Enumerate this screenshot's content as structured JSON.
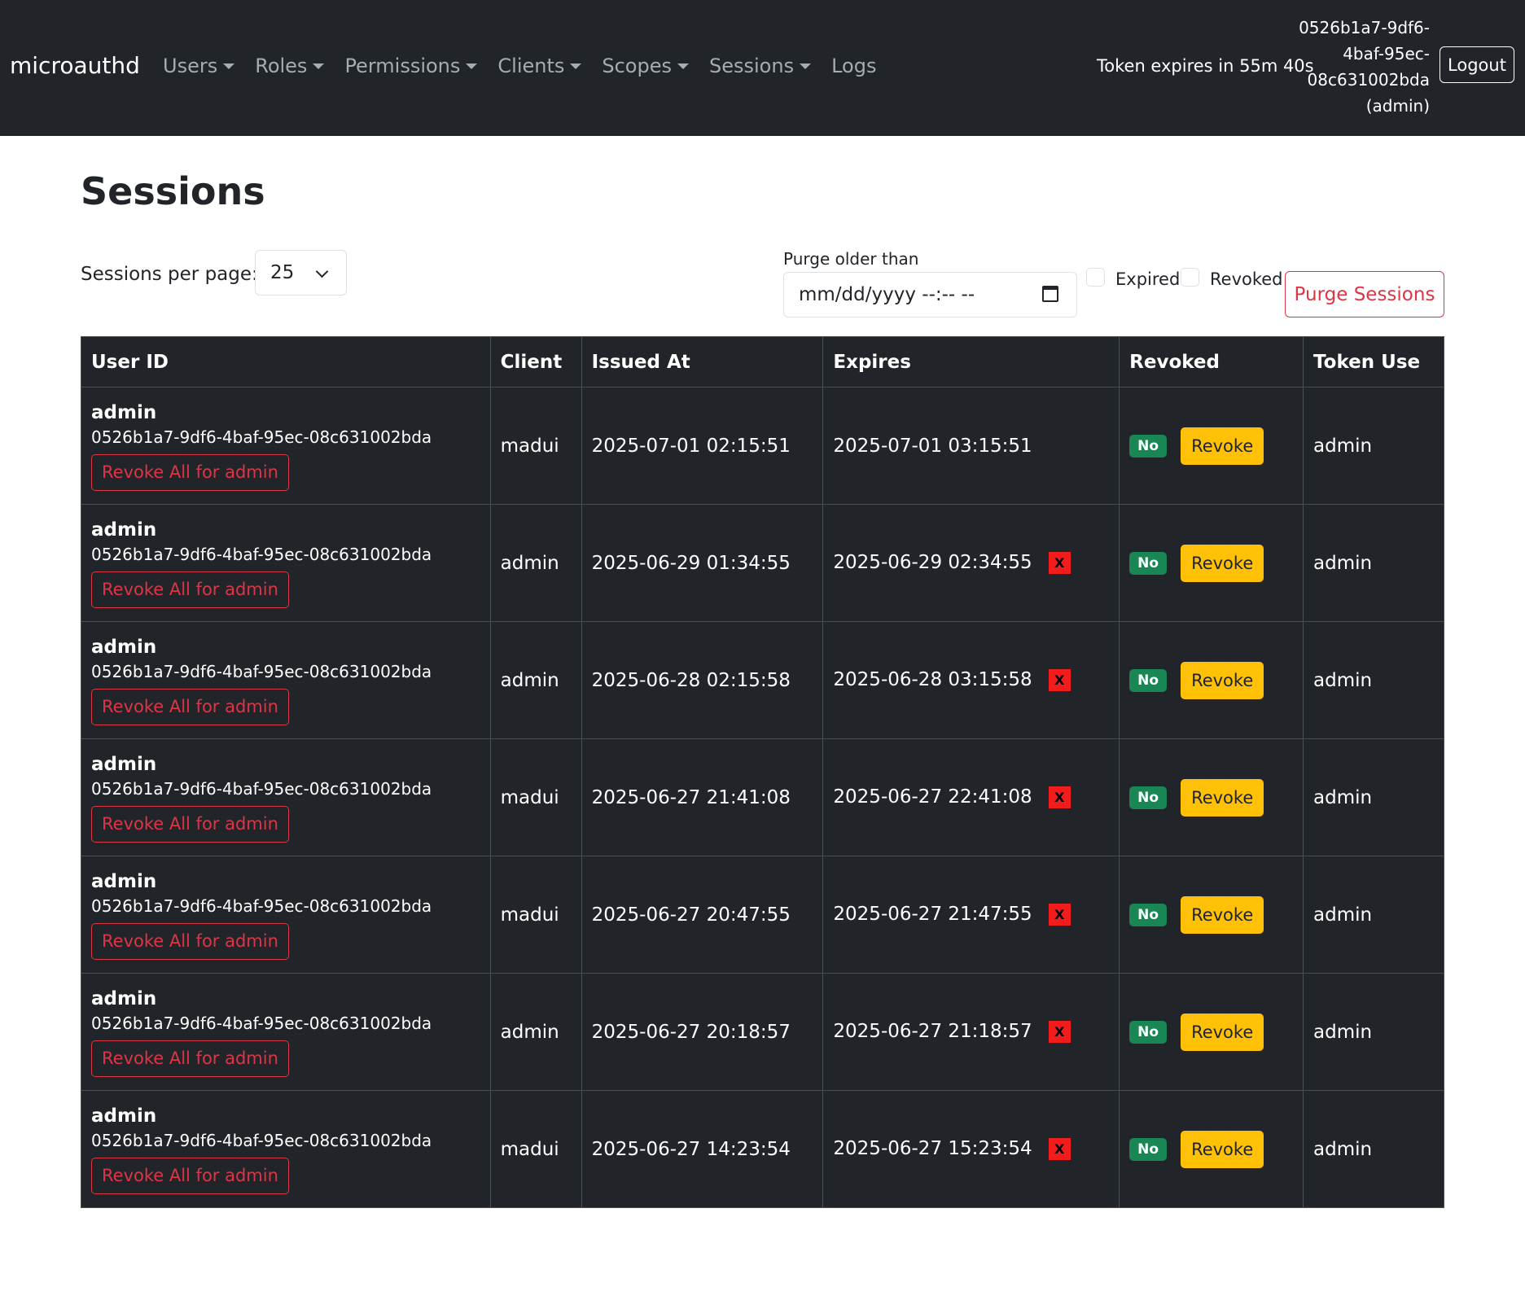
{
  "navbar": {
    "brand": "microauthd",
    "items": [
      {
        "label": "Users",
        "dropdown": true
      },
      {
        "label": "Roles",
        "dropdown": true
      },
      {
        "label": "Permissions",
        "dropdown": true
      },
      {
        "label": "Clients",
        "dropdown": true
      },
      {
        "label": "Scopes",
        "dropdown": true
      },
      {
        "label": "Sessions",
        "dropdown": true
      },
      {
        "label": "Logs",
        "dropdown": false
      }
    ],
    "token_expires": "Token expires in 55m 40s",
    "user_line1": "0526b1a7-9df6-",
    "user_line2": "4baf-95ec-",
    "user_line3": "08c631002bda",
    "user_line4": "(admin)",
    "logout_label": "Logout"
  },
  "page": {
    "title": "Sessions",
    "per_page_label": "Sessions per page:",
    "per_page_value": "25",
    "purge_label": "Purge older than",
    "purge_placeholder": "mm/dd/yyyy --:-- --",
    "expired_label": "Expired",
    "revoked_label": "Revoked",
    "purge_button": "Purge Sessions"
  },
  "table": {
    "headers": [
      "User ID",
      "Client",
      "Issued At",
      "Expires",
      "Revoked",
      "Token Use"
    ],
    "rows": [
      {
        "user": "admin",
        "user_id": "0526b1a7-9df6-4baf-95ec-08c631002bda",
        "revoke_all": "Revoke All for admin",
        "client": "madui",
        "issued": "2025-07-01 02:15:51",
        "expires": "2025-07-01 03:15:51",
        "expired": false,
        "revoked": "No",
        "revoke_label": "Revoke",
        "token_use": "admin"
      },
      {
        "user": "admin",
        "user_id": "0526b1a7-9df6-4baf-95ec-08c631002bda",
        "revoke_all": "Revoke All for admin",
        "client": "admin",
        "issued": "2025-06-29 01:34:55",
        "expires": "2025-06-29 02:34:55",
        "expired": true,
        "revoked": "No",
        "revoke_label": "Revoke",
        "token_use": "admin"
      },
      {
        "user": "admin",
        "user_id": "0526b1a7-9df6-4baf-95ec-08c631002bda",
        "revoke_all": "Revoke All for admin",
        "client": "admin",
        "issued": "2025-06-28 02:15:58",
        "expires": "2025-06-28 03:15:58",
        "expired": true,
        "revoked": "No",
        "revoke_label": "Revoke",
        "token_use": "admin"
      },
      {
        "user": "admin",
        "user_id": "0526b1a7-9df6-4baf-95ec-08c631002bda",
        "revoke_all": "Revoke All for admin",
        "client": "madui",
        "issued": "2025-06-27 21:41:08",
        "expires": "2025-06-27 22:41:08",
        "expired": true,
        "revoked": "No",
        "revoke_label": "Revoke",
        "token_use": "admin"
      },
      {
        "user": "admin",
        "user_id": "0526b1a7-9df6-4baf-95ec-08c631002bda",
        "revoke_all": "Revoke All for admin",
        "client": "madui",
        "issued": "2025-06-27 20:47:55",
        "expires": "2025-06-27 21:47:55",
        "expired": true,
        "revoked": "No",
        "revoke_label": "Revoke",
        "token_use": "admin"
      },
      {
        "user": "admin",
        "user_id": "0526b1a7-9df6-4baf-95ec-08c631002bda",
        "revoke_all": "Revoke All for admin",
        "client": "admin",
        "issued": "2025-06-27 20:18:57",
        "expires": "2025-06-27 21:18:57",
        "expired": true,
        "revoked": "No",
        "revoke_label": "Revoke",
        "token_use": "admin"
      },
      {
        "user": "admin",
        "user_id": "0526b1a7-9df6-4baf-95ec-08c631002bda",
        "revoke_all": "Revoke All for admin",
        "client": "madui",
        "issued": "2025-06-27 14:23:54",
        "expires": "2025-06-27 15:23:54",
        "expired": true,
        "revoked": "No",
        "revoke_label": "Revoke",
        "token_use": "admin"
      }
    ],
    "expired_icon": "x-mark-icon",
    "expired_mark": "X"
  },
  "colors": {
    "navbar_bg": "#212529",
    "table_bg": "#212529",
    "danger": "#dc3545",
    "warning": "#ffc107",
    "success": "#198754"
  }
}
